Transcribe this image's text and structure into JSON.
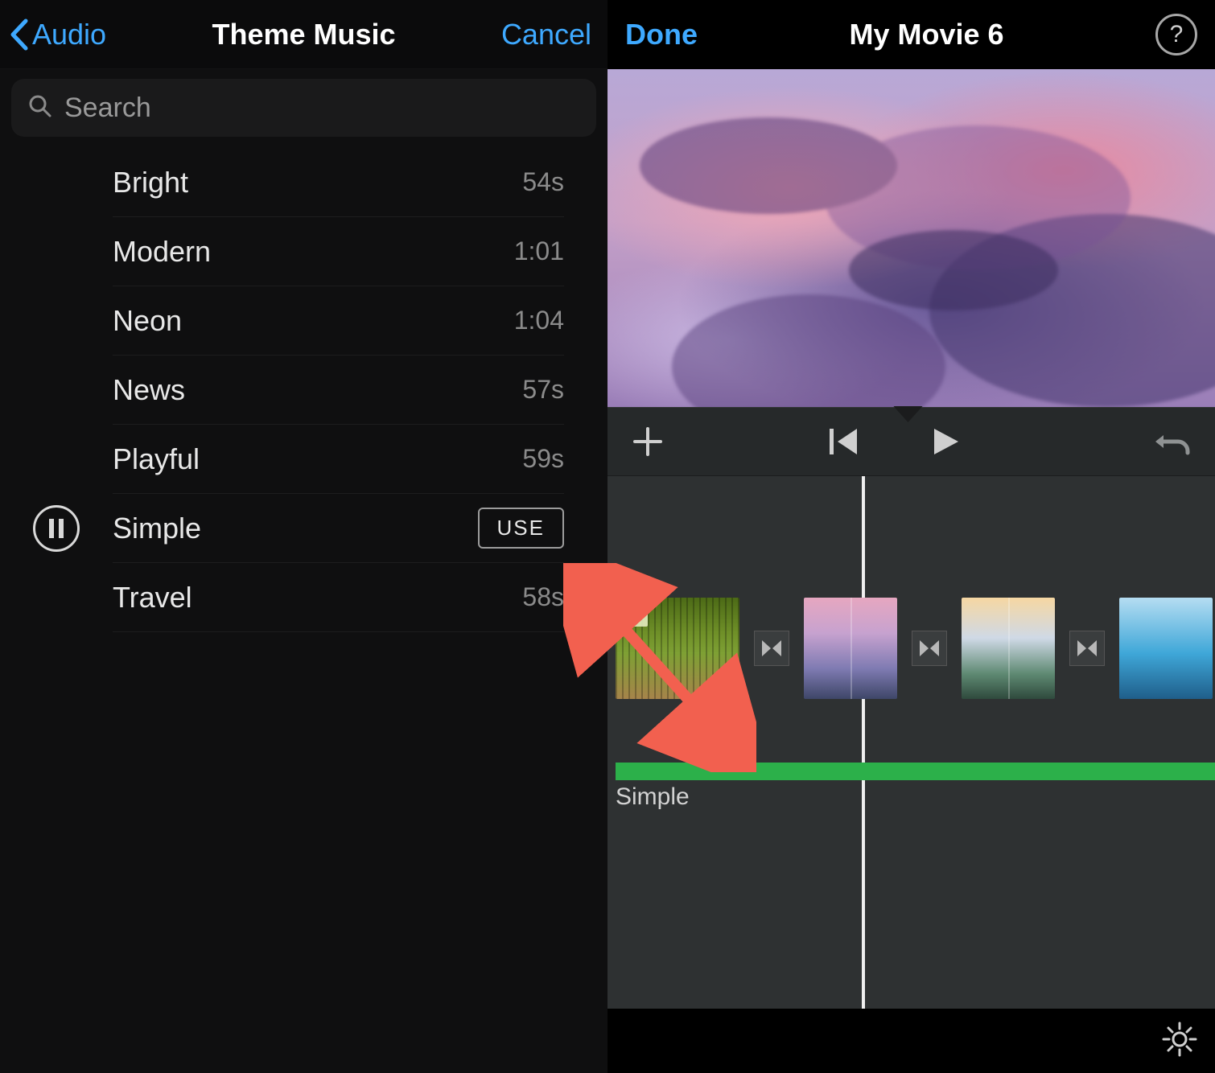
{
  "left": {
    "back_label": "Audio",
    "title": "Theme Music",
    "cancel": "Cancel",
    "search_placeholder": "Search",
    "tracks": [
      {
        "name": "Bright",
        "duration": "54s",
        "selected": false
      },
      {
        "name": "Modern",
        "duration": "1:01",
        "selected": false
      },
      {
        "name": "Neon",
        "duration": "1:04",
        "selected": false
      },
      {
        "name": "News",
        "duration": "57s",
        "selected": false
      },
      {
        "name": "Playful",
        "duration": "59s",
        "selected": false
      },
      {
        "name": "Simple",
        "duration": "",
        "selected": true
      },
      {
        "name": "Travel",
        "duration": "58s",
        "selected": false
      }
    ],
    "use_label": "USE"
  },
  "right": {
    "done": "Done",
    "title": "My Movie 6",
    "audio_clip_label": "Simple",
    "t_badge": "T"
  }
}
